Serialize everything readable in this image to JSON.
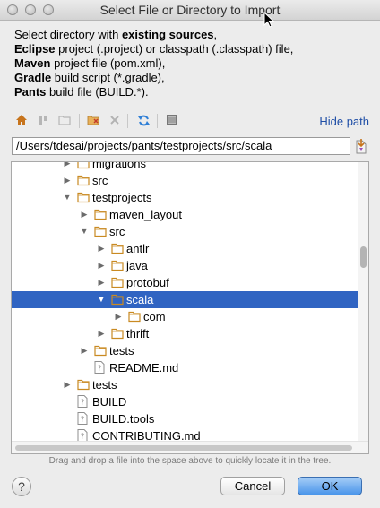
{
  "window": {
    "title": "Select File or Directory to Import"
  },
  "description": [
    [
      {
        "t": "Select directory with ",
        "b": false
      },
      {
        "t": "existing sources",
        "b": true
      },
      {
        "t": ",",
        "b": false
      }
    ],
    [
      {
        "t": "Eclipse",
        "b": true
      },
      {
        "t": " project (.project) or classpath (.classpath) file,",
        "b": false
      }
    ],
    [
      {
        "t": "Maven",
        "b": true
      },
      {
        "t": " project file (pom.xml),",
        "b": false
      }
    ],
    [
      {
        "t": "Gradle",
        "b": true
      },
      {
        "t": " build script (*.gradle),",
        "b": false
      }
    ],
    [
      {
        "t": "Pants",
        "b": true
      },
      {
        "t": " build file (BUILD.*).",
        "b": false
      }
    ]
  ],
  "toolbar": {
    "hide_path": "Hide path",
    "icons": [
      "home-icon",
      "project-dir-icon",
      "module-dir-icon",
      "new-folder-icon",
      "delete-icon",
      "refresh-icon",
      "show-hidden-icon"
    ]
  },
  "path": {
    "value": "/Users/tdesai/projects/pants/testprojects/src/scala"
  },
  "tree": {
    "rows": [
      {
        "label": "migrations",
        "depth": 1,
        "arrow": "collapsed",
        "icon": "folder",
        "selected": false
      },
      {
        "label": "src",
        "depth": 1,
        "arrow": "collapsed",
        "icon": "folder",
        "selected": false
      },
      {
        "label": "testprojects",
        "depth": 1,
        "arrow": "expanded",
        "icon": "folder",
        "selected": false
      },
      {
        "label": "maven_layout",
        "depth": 2,
        "arrow": "collapsed",
        "icon": "folder",
        "selected": false
      },
      {
        "label": "src",
        "depth": 2,
        "arrow": "expanded",
        "icon": "folder",
        "selected": false
      },
      {
        "label": "antlr",
        "depth": 3,
        "arrow": "collapsed",
        "icon": "folder",
        "selected": false
      },
      {
        "label": "java",
        "depth": 3,
        "arrow": "collapsed",
        "icon": "folder",
        "selected": false
      },
      {
        "label": "protobuf",
        "depth": 3,
        "arrow": "collapsed",
        "icon": "folder",
        "selected": false
      },
      {
        "label": "scala",
        "depth": 3,
        "arrow": "expanded",
        "icon": "folder",
        "selected": true
      },
      {
        "label": "com",
        "depth": 4,
        "arrow": "collapsed",
        "icon": "folder",
        "selected": false
      },
      {
        "label": "thrift",
        "depth": 3,
        "arrow": "collapsed",
        "icon": "folder",
        "selected": false
      },
      {
        "label": "tests",
        "depth": 2,
        "arrow": "collapsed",
        "icon": "folder",
        "selected": false
      },
      {
        "label": "README.md",
        "depth": 2,
        "arrow": "none",
        "icon": "file",
        "selected": false
      },
      {
        "label": "tests",
        "depth": 1,
        "arrow": "collapsed",
        "icon": "folder",
        "selected": false
      },
      {
        "label": "BUILD",
        "depth": 1,
        "arrow": "none",
        "icon": "file",
        "selected": false
      },
      {
        "label": "BUILD.tools",
        "depth": 1,
        "arrow": "none",
        "icon": "file",
        "selected": false
      },
      {
        "label": "CONTRIBUTING.md",
        "depth": 1,
        "arrow": "none",
        "icon": "file",
        "selected": false
      }
    ]
  },
  "hint": "Drag and drop a file into the space above to quickly locate it in the tree.",
  "buttons": {
    "help": "?",
    "cancel": "Cancel",
    "ok": "OK"
  },
  "colors": {
    "selection": "#3064c2",
    "folder": "#e8b15a",
    "link": "#1f4ea6",
    "ok_button": "#4a95ea"
  }
}
